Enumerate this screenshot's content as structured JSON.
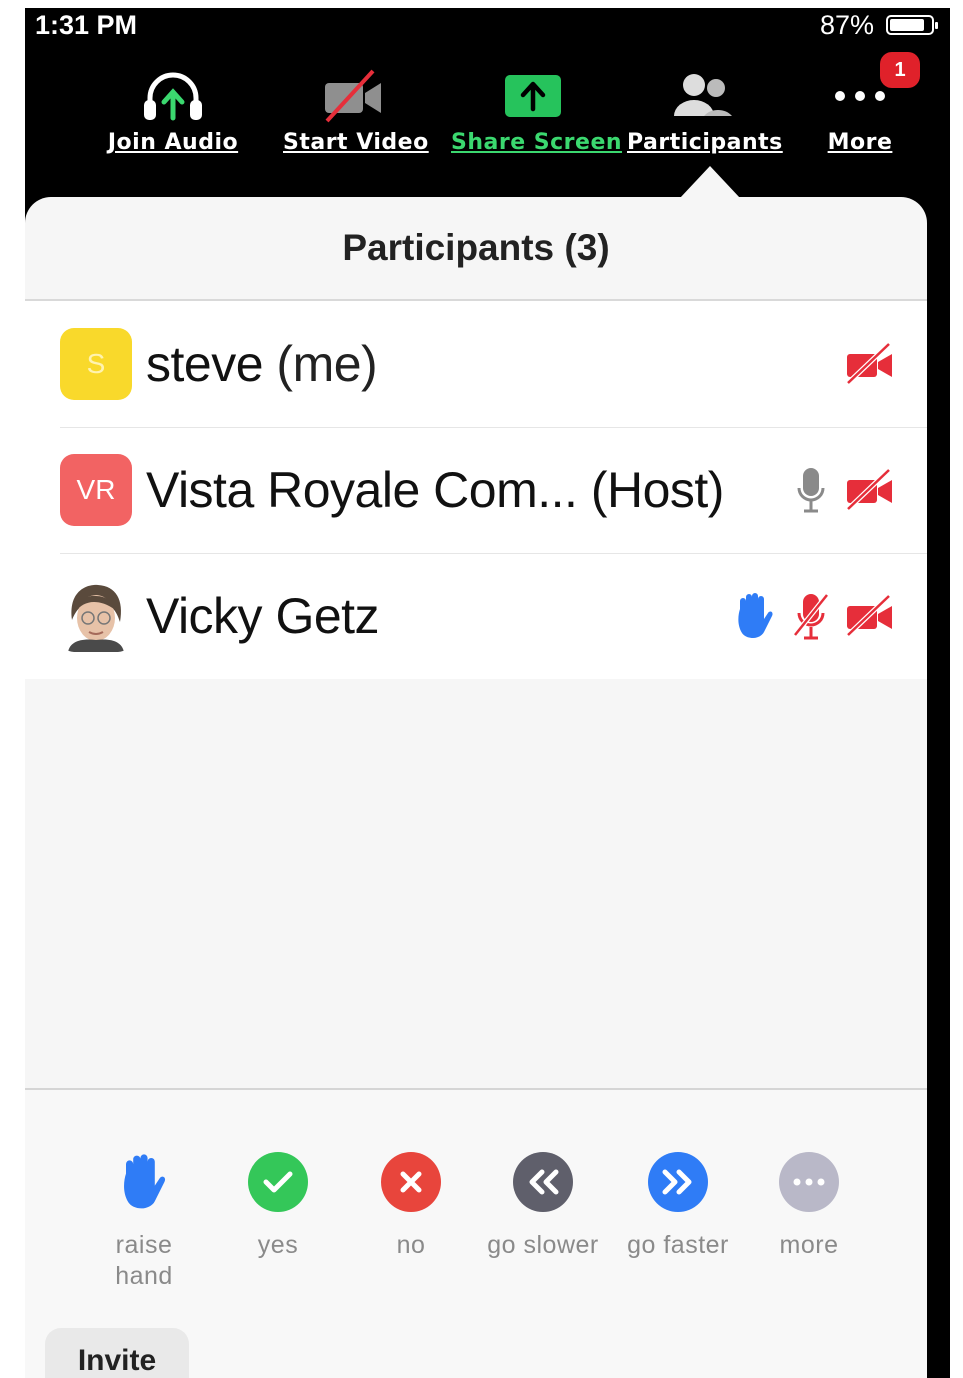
{
  "status_bar": {
    "time": "1:31 PM",
    "battery": "87%"
  },
  "toolbar": {
    "join_audio": "Join Audio",
    "start_video": "Start Video",
    "share_screen": "Share Screen",
    "participants": "Participants",
    "more": "More",
    "more_badge": "1"
  },
  "panel": {
    "title": "Participants (3)",
    "participants": [
      {
        "initials": "S",
        "name": "steve",
        "suffix": "(me)",
        "icons": [
          "video-off"
        ]
      },
      {
        "initials": "VR",
        "name": "Vista Royale Com...",
        "suffix": "(Host)",
        "icons": [
          "mic-gray",
          "video-off"
        ]
      },
      {
        "initials": "",
        "name": "Vicky Getz",
        "suffix": "",
        "icons": [
          "raised-hand",
          "mic-muted",
          "video-off"
        ]
      }
    ]
  },
  "reactions": [
    {
      "icon": "raise-hand-icon",
      "label_line1": "raise",
      "label_line2": "hand"
    },
    {
      "icon": "checkmark-icon",
      "label_line1": "yes",
      "label_line2": ""
    },
    {
      "icon": "x-icon",
      "label_line1": "no",
      "label_line2": ""
    },
    {
      "icon": "rewind-icon",
      "label_line1": "go slower",
      "label_line2": ""
    },
    {
      "icon": "fast-forward-icon",
      "label_line1": "go faster",
      "label_line2": ""
    },
    {
      "icon": "ellipsis-icon",
      "label_line1": "more",
      "label_line2": ""
    }
  ],
  "invite_label": "Invite",
  "colors": {
    "share_green": "#3bd86f",
    "badge_red": "#e0212a",
    "video_off_red": "#e62e3a",
    "hand_blue": "#2f7cf6",
    "yes_green": "#34c759",
    "no_red": "#e8453c",
    "slower_gray": "#5f5f6b",
    "faster_blue": "#2f7cf6",
    "more_gray": "#b9b8c8"
  }
}
